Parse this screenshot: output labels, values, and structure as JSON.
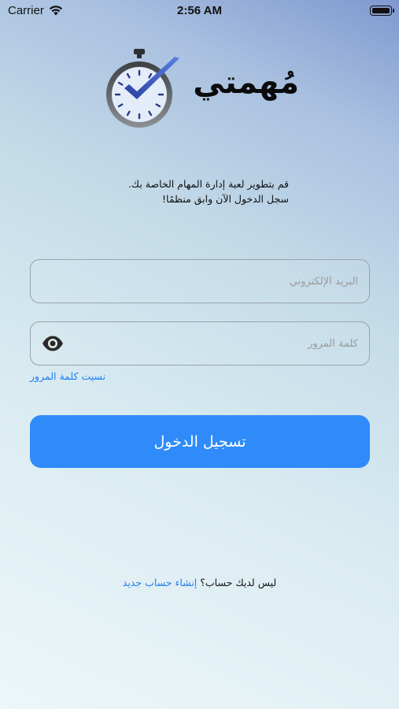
{
  "status_bar": {
    "carrier": "Carrier",
    "time": "2:56 AM",
    "wifi_icon": "wifi-icon",
    "battery_icon": "battery-icon"
  },
  "app": {
    "name": "مُهمتي",
    "logo_icon": "stopwatch-check-icon"
  },
  "intro": {
    "line1": "قم بتطوير لعبة إدارة المهام الخاصة بك.",
    "line2": "سجل الدخول الآن وابق منظمًا!"
  },
  "form": {
    "email_placeholder": "البريد الإلكتروني",
    "email_value": "",
    "password_placeholder": "كلمة المرور",
    "password_value": "",
    "show_password_icon": "eye-icon",
    "forgot_password": "نسيت كلمة المرور",
    "login_button": "تسجيل الدخول"
  },
  "signup": {
    "prompt": "ليس لديك حساب؟",
    "link": "إنشاء حساب جديد"
  },
  "colors": {
    "accent": "#2f8bfa",
    "link": "#1e7ef2",
    "field_border": "#9aa3ab"
  }
}
